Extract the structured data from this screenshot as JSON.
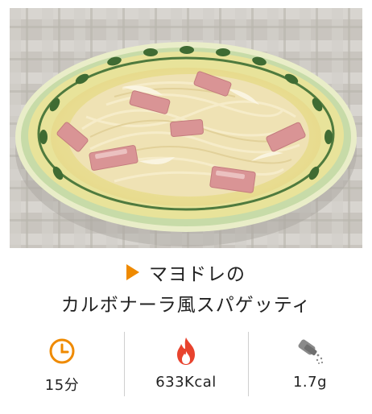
{
  "recipe": {
    "title_line1": "マヨドレの",
    "title_line2": "カルボナーラ風スパゲッティ"
  },
  "stats": {
    "time": "15分",
    "calories": "633Kcal",
    "salt": "1.7g"
  },
  "icons": {
    "title_marker": "play-triangle-icon",
    "time": "clock-icon",
    "calories": "flame-icon",
    "salt": "salt-shaker-icon"
  },
  "colors": {
    "accent": "#ef8a00",
    "flame": "#e8432e",
    "divider": "#cfcfcf"
  }
}
